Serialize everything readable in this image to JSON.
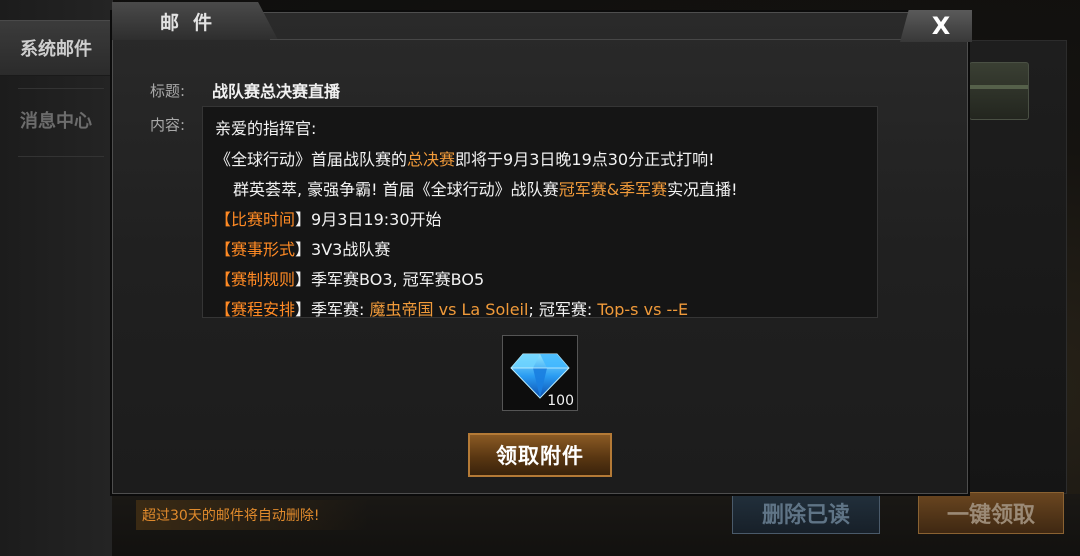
{
  "window": {
    "title": "邮件",
    "close_label": "X"
  },
  "sidebar": {
    "tabs": [
      {
        "label": "系统邮件",
        "active": true
      },
      {
        "label": "消息中心",
        "active": false
      }
    ]
  },
  "mail": {
    "subject_label": "标题:",
    "subject": "战队赛总决赛直播",
    "content_label": "内容:",
    "lines": [
      {
        "parts": [
          "亲爱的指挥官:"
        ]
      },
      {
        "parts": [
          "《全球行动》首届战队赛的",
          "总决赛",
          "即将于9月3日晚19点30分正式打响!"
        ]
      },
      {
        "parts": [
          "群英荟萃, 豪强争霸! 首届《全球行动》战队赛",
          "冠军赛&季军赛",
          "实况直播!"
        ]
      },
      {
        "parts": [
          "【",
          "比赛时间",
          "】9月3日19:30开始"
        ]
      },
      {
        "parts": [
          "【",
          "赛事形式",
          "】3V3战队赛"
        ]
      },
      {
        "parts": [
          "【",
          "赛制规则",
          "】季军赛BO3, 冠军赛BO5"
        ]
      },
      {
        "parts": [
          "【",
          "赛程安排",
          "】季军赛: ",
          "魔虫帝国 vs La Soleil",
          "; 冠军赛: ",
          "Top-s vs --E"
        ]
      }
    ]
  },
  "attachment": {
    "item": "diamond-icon",
    "count": "100"
  },
  "actions": {
    "claim_label": "领取附件",
    "delete_read_label": "删除已读",
    "collect_all_label": "一键领取"
  },
  "footer": {
    "auto_delete_notice": "超过30天的邮件将自动删除!"
  },
  "colors": {
    "accent_orange": "#f09a3a",
    "content_bg": "#151515",
    "panel_bg": "#242424"
  }
}
